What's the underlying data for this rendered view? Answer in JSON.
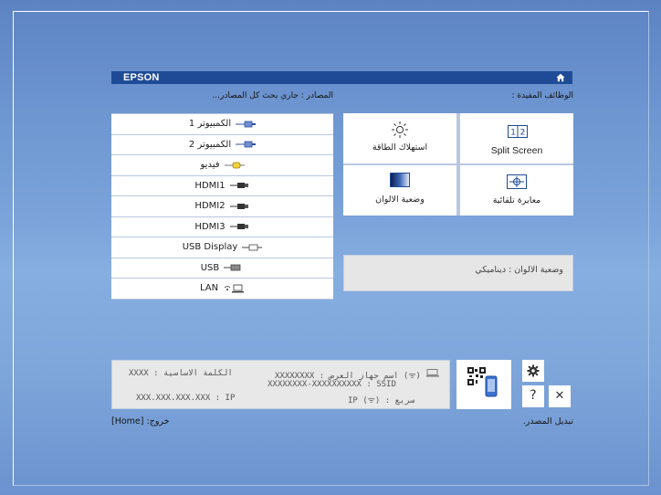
{
  "header": {
    "brand": "EPSON",
    "home_icon": "home-icon"
  },
  "sources_title": "المصادر : جاري بحث كل المصادر...",
  "functions_title": "الوظائف المفيدة :",
  "sources": [
    {
      "label": "الكمبيوتر 1",
      "icon": "computer-port-icon"
    },
    {
      "label": "الكمبيوتر 2",
      "icon": "computer-port-icon"
    },
    {
      "label": "فيديو",
      "icon": "video-port-icon"
    },
    {
      "label": "HDMI1",
      "icon": "hdmi-port-icon"
    },
    {
      "label": "HDMI2",
      "icon": "hdmi-port-icon"
    },
    {
      "label": "HDMI3",
      "icon": "hdmi-port-icon"
    },
    {
      "label": "USB Display",
      "icon": "usb-display-icon"
    },
    {
      "label": "USB",
      "icon": "usb-icon"
    },
    {
      "label": "LAN",
      "icon": "lan-icon"
    }
  ],
  "functions": {
    "split_screen": {
      "label": "Split Screen",
      "icon_text": "1 2"
    },
    "power_consumption": {
      "label": "استهلاك الطاقة"
    },
    "auto_calibration": {
      "label": "معايرة تلقائية"
    },
    "color_mode": {
      "label": "وضعية الالوان"
    }
  },
  "status": {
    "text": "وضعية الالوان  :  ديناميكي"
  },
  "network_info": {
    "projector_name": "(ᯤ) اسم جهاز العرض : XXXXXXXX",
    "ssid": "XXXXXXXX-XXXXXXXXXX : SSID",
    "ip_wireless": "سريع : IP (ᯤ)",
    "ip_wired": "XXX.XXX.XXX.XXX : IP",
    "passphrase": "الكلمة الاساسية : XXXX"
  },
  "buttons": {
    "help": "?",
    "close": "✕"
  },
  "footer": {
    "exit": "[Home] :خروج",
    "switch_source": "تبديل المصدر."
  },
  "colors": {
    "header": "#1f4b96",
    "panel": "#ffffff",
    "grid": "#b8c8e0",
    "info_bg": "#e8e8e8"
  }
}
